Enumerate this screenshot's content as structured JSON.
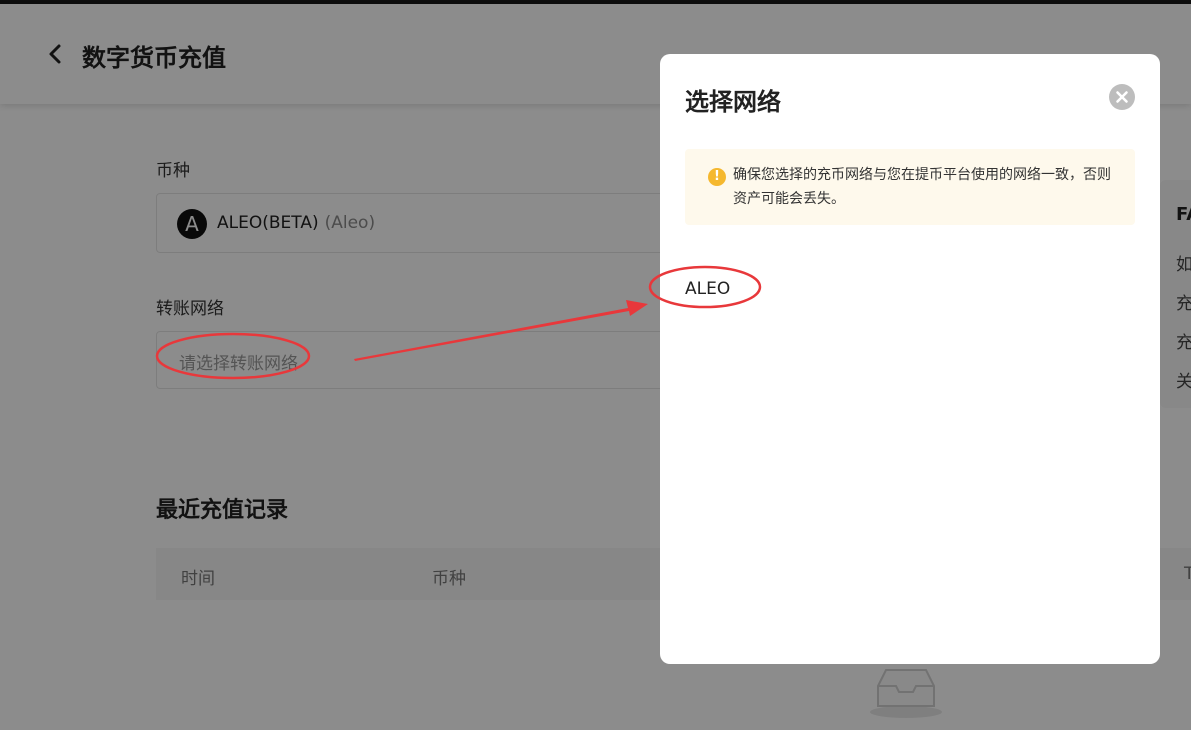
{
  "header": {
    "title": "数字货币充值"
  },
  "form": {
    "coin_label": "币种",
    "coin_name": "ALEO(BETA)",
    "coin_sub": "(Aleo)",
    "coin_logo": "A",
    "network_label": "转账网络",
    "network_placeholder": "请选择转账网络"
  },
  "records": {
    "title": "最近充值记录",
    "columns": [
      "时间",
      "币种",
      "T"
    ]
  },
  "faq": {
    "title": "FA",
    "lines": [
      "如",
      "充",
      "充",
      "关"
    ]
  },
  "modal": {
    "title": "选择网络",
    "notice": "确保您选择的充币网络与您在提币平台使用的网络一致，否则资产可能会丢失。",
    "options": [
      "ALEO"
    ]
  },
  "colors": {
    "annotation": "#e8383b",
    "warning": "#f5b82e",
    "notice_bg": "#fef9ec"
  }
}
